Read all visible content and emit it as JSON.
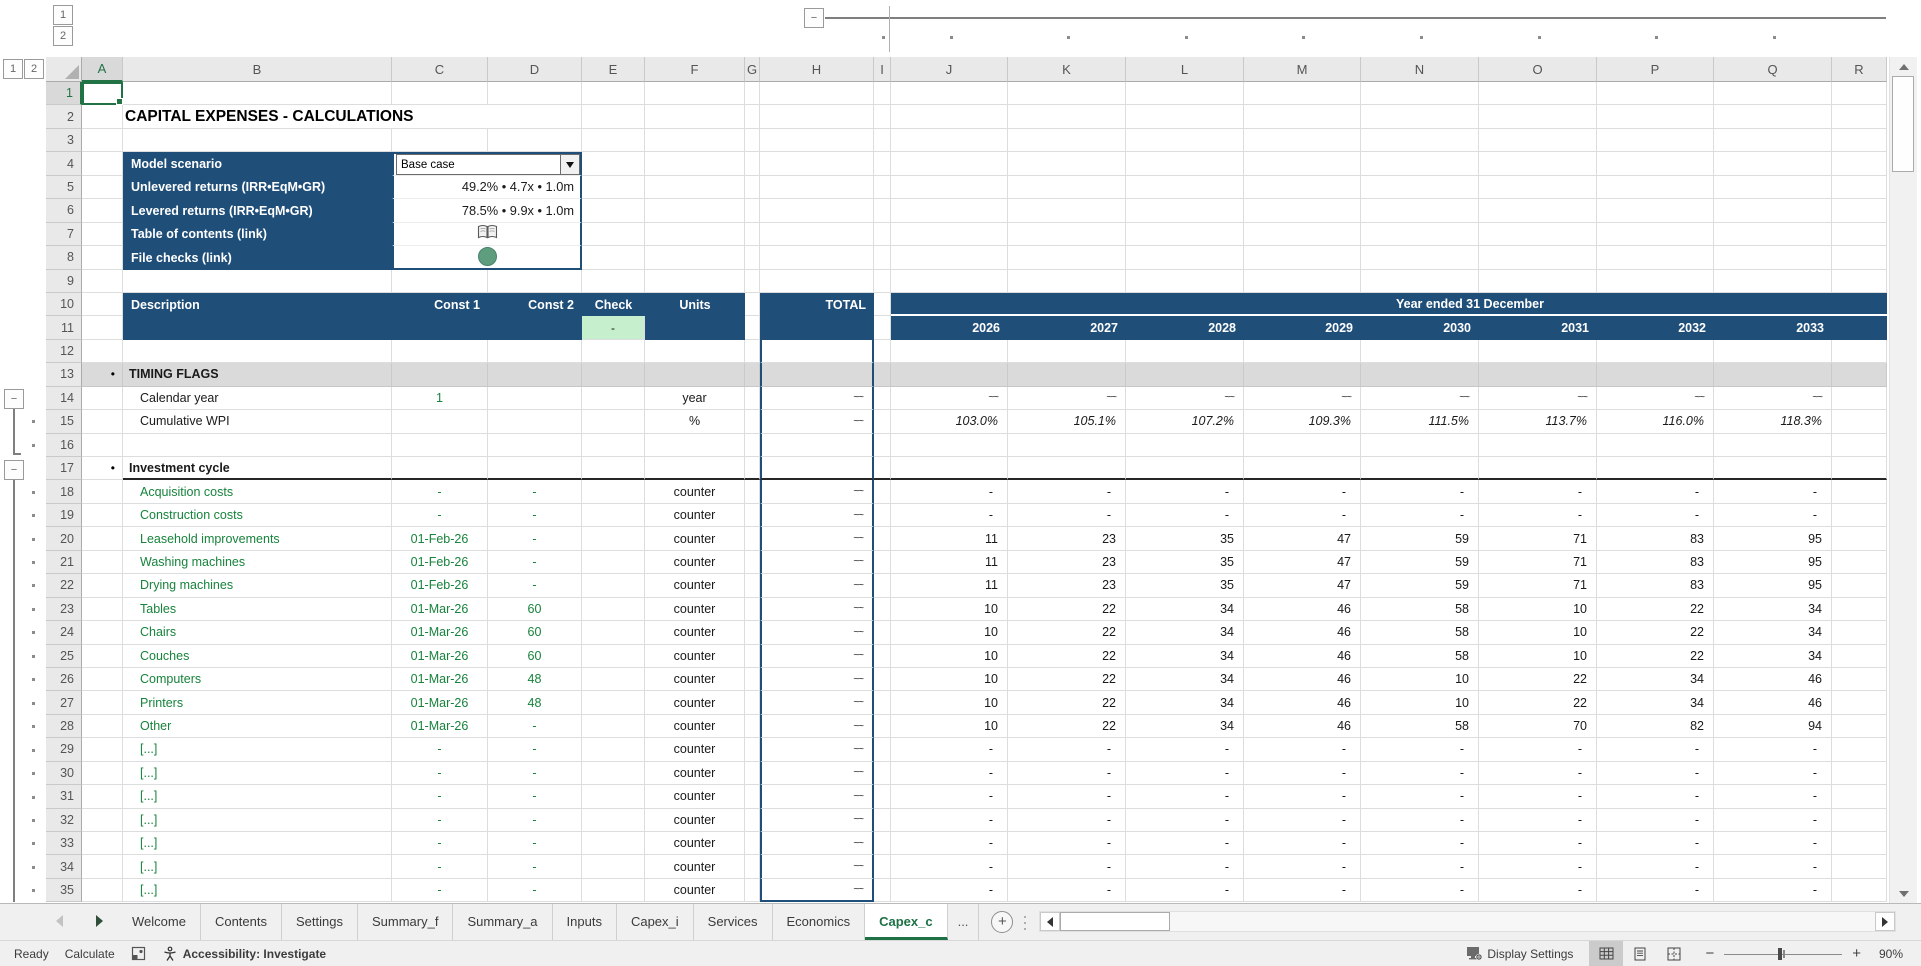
{
  "sheet": {
    "title": "CAPITAL EXPENSES - CALCULATIONS",
    "columns": [
      "A",
      "B",
      "C",
      "D",
      "E",
      "F",
      "G",
      "H",
      "I",
      "J",
      "K",
      "L",
      "M",
      "N",
      "O",
      "P",
      "Q",
      "R"
    ],
    "scenario_panel": {
      "rows": [
        {
          "label": "Model scenario",
          "type": "dropdown",
          "value": "Base case"
        },
        {
          "label": "Unlevered returns (IRR•EqM•GR)",
          "type": "value",
          "value": "49.2% • 4.7x • 1.0m"
        },
        {
          "label": "Levered returns (IRR•EqM•GR)",
          "type": "value",
          "value": "78.5% • 9.9x • 1.0m"
        },
        {
          "label": "Table of contents (link)",
          "type": "book-icon",
          "value": ""
        },
        {
          "label": "File checks (link)",
          "type": "status-circle-icon",
          "value": ""
        }
      ]
    },
    "header_band": {
      "description": "Description",
      "const1": "Const 1",
      "const2": "Const 2",
      "check": "Check",
      "units": "Units",
      "total": "TOTAL",
      "check_value": "-",
      "year_banner": "Year ended 31 December",
      "years": [
        "2026",
        "2027",
        "2028",
        "2029",
        "2030",
        "2031",
        "2032",
        "2033"
      ]
    },
    "rows": [
      {
        "n": 13,
        "type": "section",
        "bullet": "•",
        "label": "TIMING FLAGS"
      },
      {
        "n": 14,
        "type": "item",
        "label": "Calendar year",
        "label_green": false,
        "c1": "1",
        "c2": "",
        "units": "year",
        "total": "~~",
        "vals": [
          "~~",
          "~~",
          "~~",
          "~~",
          "~~",
          "~~",
          "~~",
          "~~"
        ],
        "vals_flag": true
      },
      {
        "n": 15,
        "type": "item",
        "label": "Cumulative WPI",
        "label_green": false,
        "c1": "",
        "c2": "",
        "units": "%",
        "total": "~~",
        "vals": [
          "103.0%",
          "105.1%",
          "107.2%",
          "109.3%",
          "111.5%",
          "113.7%",
          "116.0%",
          "118.3%"
        ],
        "italic": true
      },
      {
        "n": 17,
        "type": "section2",
        "bullet": "•",
        "label": "Investment cycle"
      },
      {
        "n": 18,
        "type": "item",
        "label": "Acquisition costs",
        "label_green": true,
        "c1": "-",
        "c2": "-",
        "units": "counter",
        "total": "~~",
        "vals": [
          "-",
          "-",
          "-",
          "-",
          "-",
          "-",
          "-",
          "-"
        ]
      },
      {
        "n": 19,
        "type": "item",
        "label": "Construction costs",
        "label_green": true,
        "c1": "-",
        "c2": "-",
        "units": "counter",
        "total": "~~",
        "vals": [
          "-",
          "-",
          "-",
          "-",
          "-",
          "-",
          "-",
          "-"
        ]
      },
      {
        "n": 20,
        "type": "item",
        "label": "Leasehold improvements",
        "label_green": true,
        "c1": "01-Feb-26",
        "c2": "-",
        "units": "counter",
        "total": "~~",
        "vals": [
          "11",
          "23",
          "35",
          "47",
          "59",
          "71",
          "83",
          "95"
        ]
      },
      {
        "n": 21,
        "type": "item",
        "label": "Washing machines",
        "label_green": true,
        "c1": "01-Feb-26",
        "c2": "-",
        "units": "counter",
        "total": "~~",
        "vals": [
          "11",
          "23",
          "35",
          "47",
          "59",
          "71",
          "83",
          "95"
        ]
      },
      {
        "n": 22,
        "type": "item",
        "label": "Drying machines",
        "label_green": true,
        "c1": "01-Feb-26",
        "c2": "-",
        "units": "counter",
        "total": "~~",
        "vals": [
          "11",
          "23",
          "35",
          "47",
          "59",
          "71",
          "83",
          "95"
        ]
      },
      {
        "n": 23,
        "type": "item",
        "label": "Tables",
        "label_green": true,
        "c1": "01-Mar-26",
        "c2": "60",
        "units": "counter",
        "total": "~~",
        "vals": [
          "10",
          "22",
          "34",
          "46",
          "58",
          "10",
          "22",
          "34"
        ]
      },
      {
        "n": 24,
        "type": "item",
        "label": "Chairs",
        "label_green": true,
        "c1": "01-Mar-26",
        "c2": "60",
        "units": "counter",
        "total": "~~",
        "vals": [
          "10",
          "22",
          "34",
          "46",
          "58",
          "10",
          "22",
          "34"
        ]
      },
      {
        "n": 25,
        "type": "item",
        "label": "Couches",
        "label_green": true,
        "c1": "01-Mar-26",
        "c2": "60",
        "units": "counter",
        "total": "~~",
        "vals": [
          "10",
          "22",
          "34",
          "46",
          "58",
          "10",
          "22",
          "34"
        ]
      },
      {
        "n": 26,
        "type": "item",
        "label": "Computers",
        "label_green": true,
        "c1": "01-Mar-26",
        "c2": "48",
        "units": "counter",
        "total": "~~",
        "vals": [
          "10",
          "22",
          "34",
          "46",
          "10",
          "22",
          "34",
          "46"
        ]
      },
      {
        "n": 27,
        "type": "item",
        "label": "Printers",
        "label_green": true,
        "c1": "01-Mar-26",
        "c2": "48",
        "units": "counter",
        "total": "~~",
        "vals": [
          "10",
          "22",
          "34",
          "46",
          "10",
          "22",
          "34",
          "46"
        ]
      },
      {
        "n": 28,
        "type": "item",
        "label": "Other",
        "label_green": true,
        "c1": "01-Mar-26",
        "c2": "-",
        "units": "counter",
        "total": "~~",
        "vals": [
          "10",
          "22",
          "34",
          "46",
          "58",
          "70",
          "82",
          "94"
        ]
      },
      {
        "n": 29,
        "type": "item",
        "label": "[...]",
        "label_green": true,
        "c1": "-",
        "c2": "-",
        "units": "counter",
        "total": "~~",
        "vals": [
          "-",
          "-",
          "-",
          "-",
          "-",
          "-",
          "-",
          "-"
        ]
      },
      {
        "n": 30,
        "type": "item",
        "label": "[...]",
        "label_green": true,
        "c1": "-",
        "c2": "-",
        "units": "counter",
        "total": "~~",
        "vals": [
          "-",
          "-",
          "-",
          "-",
          "-",
          "-",
          "-",
          "-"
        ]
      },
      {
        "n": 31,
        "type": "item",
        "label": "[...]",
        "label_green": true,
        "c1": "-",
        "c2": "-",
        "units": "counter",
        "total": "~~",
        "vals": [
          "-",
          "-",
          "-",
          "-",
          "-",
          "-",
          "-",
          "-"
        ]
      },
      {
        "n": 32,
        "type": "item",
        "label": "[...]",
        "label_green": true,
        "c1": "-",
        "c2": "-",
        "units": "counter",
        "total": "~~",
        "vals": [
          "-",
          "-",
          "-",
          "-",
          "-",
          "-",
          "-",
          "-"
        ]
      },
      {
        "n": 33,
        "type": "item",
        "label": "[...]",
        "label_green": true,
        "c1": "-",
        "c2": "-",
        "units": "counter",
        "total": "~~",
        "vals": [
          "-",
          "-",
          "-",
          "-",
          "-",
          "-",
          "-",
          "-"
        ]
      },
      {
        "n": 34,
        "type": "item",
        "label": "[...]",
        "label_green": true,
        "c1": "-",
        "c2": "-",
        "units": "counter",
        "total": "~~",
        "vals": [
          "-",
          "-",
          "-",
          "-",
          "-",
          "-",
          "-",
          "-"
        ]
      },
      {
        "n": 35,
        "type": "item",
        "label": "[...]",
        "label_green": true,
        "c1": "-",
        "c2": "-",
        "units": "counter",
        "total": "~~",
        "vals": [
          "-",
          "-",
          "-",
          "-",
          "-",
          "-",
          "-",
          "-"
        ]
      }
    ]
  },
  "outline": {
    "row_levels": [
      "1",
      "2"
    ],
    "col_levels": [
      "1",
      "2"
    ]
  },
  "sheet_tabs": {
    "items": [
      "Welcome",
      "Contents",
      "Settings",
      "Summary_f",
      "Summary_a",
      "Inputs",
      "Capex_i",
      "Services",
      "Economics",
      "Capex_c"
    ],
    "active": "Capex_c",
    "overflow_label": "...",
    "add_label": "+"
  },
  "status_bar": {
    "ready": "Ready",
    "calculate": "Calculate",
    "accessibility": "Accessibility: Investigate",
    "display_settings": "Display Settings",
    "zoom_level": "90%"
  }
}
